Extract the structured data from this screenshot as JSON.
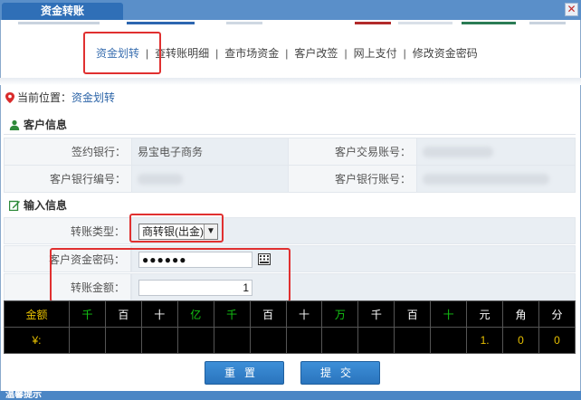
{
  "window": {
    "title": "资金转账",
    "close_glyph": "✕"
  },
  "colors": {
    "titlebar": "#5a8fc9",
    "tab": "#2f6fb7",
    "highlight": "#e03030",
    "button": "#2a74bd",
    "grid_bg": "#000000",
    "grid_yellow": "#e7c000",
    "grid_green": "#14c414"
  },
  "nav": {
    "items": [
      {
        "label": "资金划转",
        "active": true
      },
      {
        "label": "查转账明细",
        "active": false
      },
      {
        "label": "查市场资金",
        "active": false
      },
      {
        "label": "客户改签",
        "active": false
      },
      {
        "label": "网上支付",
        "active": false
      },
      {
        "label": "修改资金密码",
        "active": false
      }
    ],
    "separator": "|"
  },
  "breadcrumb": {
    "prefix": "当前位置：",
    "location": "资金划转",
    "icon": "location-pin-icon"
  },
  "customer_info": {
    "title": "客户信息",
    "icon": "user-icon",
    "rows": [
      {
        "label1": "签约银行：",
        "value1": "易宝电子商务",
        "label2": "客户交易账号：",
        "value2": ""
      },
      {
        "label1": "客户银行编号：",
        "value1": "",
        "label2": "客户银行账号：",
        "value2": ""
      }
    ]
  },
  "input_info": {
    "title": "输入信息",
    "icon": "edit-icon",
    "transfer_type": {
      "label": "转账类型：",
      "selected": "商转银(出金)"
    },
    "password": {
      "label": "客户资金密码：",
      "value": "●●●●●●",
      "keyboard_icon": "keyboard-icon"
    },
    "amount": {
      "label": "转账金额：",
      "value": "1"
    }
  },
  "digit_grid": {
    "header": [
      {
        "text": "金额",
        "color": "yellow"
      },
      {
        "text": "千",
        "color": "green"
      },
      {
        "text": "百",
        "color": "white"
      },
      {
        "text": "十",
        "color": "white"
      },
      {
        "text": "亿",
        "color": "green"
      },
      {
        "text": "千",
        "color": "green"
      },
      {
        "text": "百",
        "color": "white"
      },
      {
        "text": "十",
        "color": "white"
      },
      {
        "text": "万",
        "color": "green"
      },
      {
        "text": "千",
        "color": "white"
      },
      {
        "text": "百",
        "color": "white"
      },
      {
        "text": "十",
        "color": "green"
      },
      {
        "text": "元",
        "color": "white"
      },
      {
        "text": "角",
        "color": "white"
      },
      {
        "text": "分",
        "color": "white"
      }
    ],
    "values": [
      {
        "text": "¥:",
        "color": "yellow"
      },
      {
        "text": "",
        "color": "white"
      },
      {
        "text": "",
        "color": "white"
      },
      {
        "text": "",
        "color": "white"
      },
      {
        "text": "",
        "color": "white"
      },
      {
        "text": "",
        "color": "white"
      },
      {
        "text": "",
        "color": "white"
      },
      {
        "text": "",
        "color": "white"
      },
      {
        "text": "",
        "color": "white"
      },
      {
        "text": "",
        "color": "white"
      },
      {
        "text": "",
        "color": "white"
      },
      {
        "text": "",
        "color": "white"
      },
      {
        "text": "1.",
        "color": "yellow"
      },
      {
        "text": "0",
        "color": "yellow"
      },
      {
        "text": "0",
        "color": "yellow"
      }
    ]
  },
  "buttons": {
    "reset": "重置",
    "submit": "提交"
  },
  "footer": {
    "label": "温馨提示"
  }
}
